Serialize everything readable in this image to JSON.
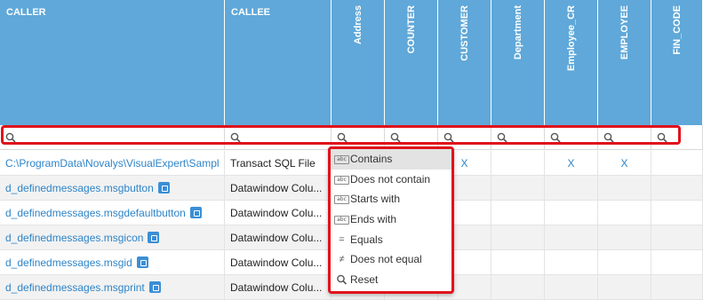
{
  "columns": {
    "caller": "CALLER",
    "callee": "CALLEE",
    "vertical": [
      "Address",
      "COUNTER",
      "CUSTOMER",
      "Department",
      "Employee_CR",
      "EMPLOYEE",
      "FIN_CODE"
    ]
  },
  "rows": [
    {
      "caller": "C:\\ProgramData\\Novalys\\VisualExpert\\Sampl",
      "callee": "Transact SQL File",
      "marks": {
        "CUSTOMER": "X",
        "Employee_CR": "X",
        "EMPLOYEE": "X"
      },
      "icon": false
    },
    {
      "caller": "d_definedmessages.msgbutton",
      "callee": "Datawindow Colu...",
      "icon": true
    },
    {
      "caller": "d_definedmessages.msgdefaultbutton",
      "callee": "Datawindow Colu...",
      "icon": true
    },
    {
      "caller": "d_definedmessages.msgicon",
      "callee": "Datawindow Colu...",
      "icon": true
    },
    {
      "caller": "d_definedmessages.msgid",
      "callee": "Datawindow Colu...",
      "icon": true
    },
    {
      "caller": "d_definedmessages.msgprint",
      "callee": "Datawindow Colu...",
      "icon": true
    }
  ],
  "filter_menu": {
    "items": [
      {
        "label": "Contains",
        "icon": "contains-icon",
        "selected": true
      },
      {
        "label": "Does not contain",
        "icon": "does-not-contain-icon"
      },
      {
        "label": "Starts with",
        "icon": "starts-with-icon"
      },
      {
        "label": "Ends with",
        "icon": "ends-with-icon"
      },
      {
        "label": "Equals",
        "icon": "equals-icon"
      },
      {
        "label": "Does not equal",
        "icon": "not-equal-icon"
      },
      {
        "label": "Reset",
        "icon": "search-icon"
      }
    ]
  },
  "colors": {
    "header": "#5fa8d9",
    "link": "#2e84c8",
    "highlight": "#e0121b"
  }
}
